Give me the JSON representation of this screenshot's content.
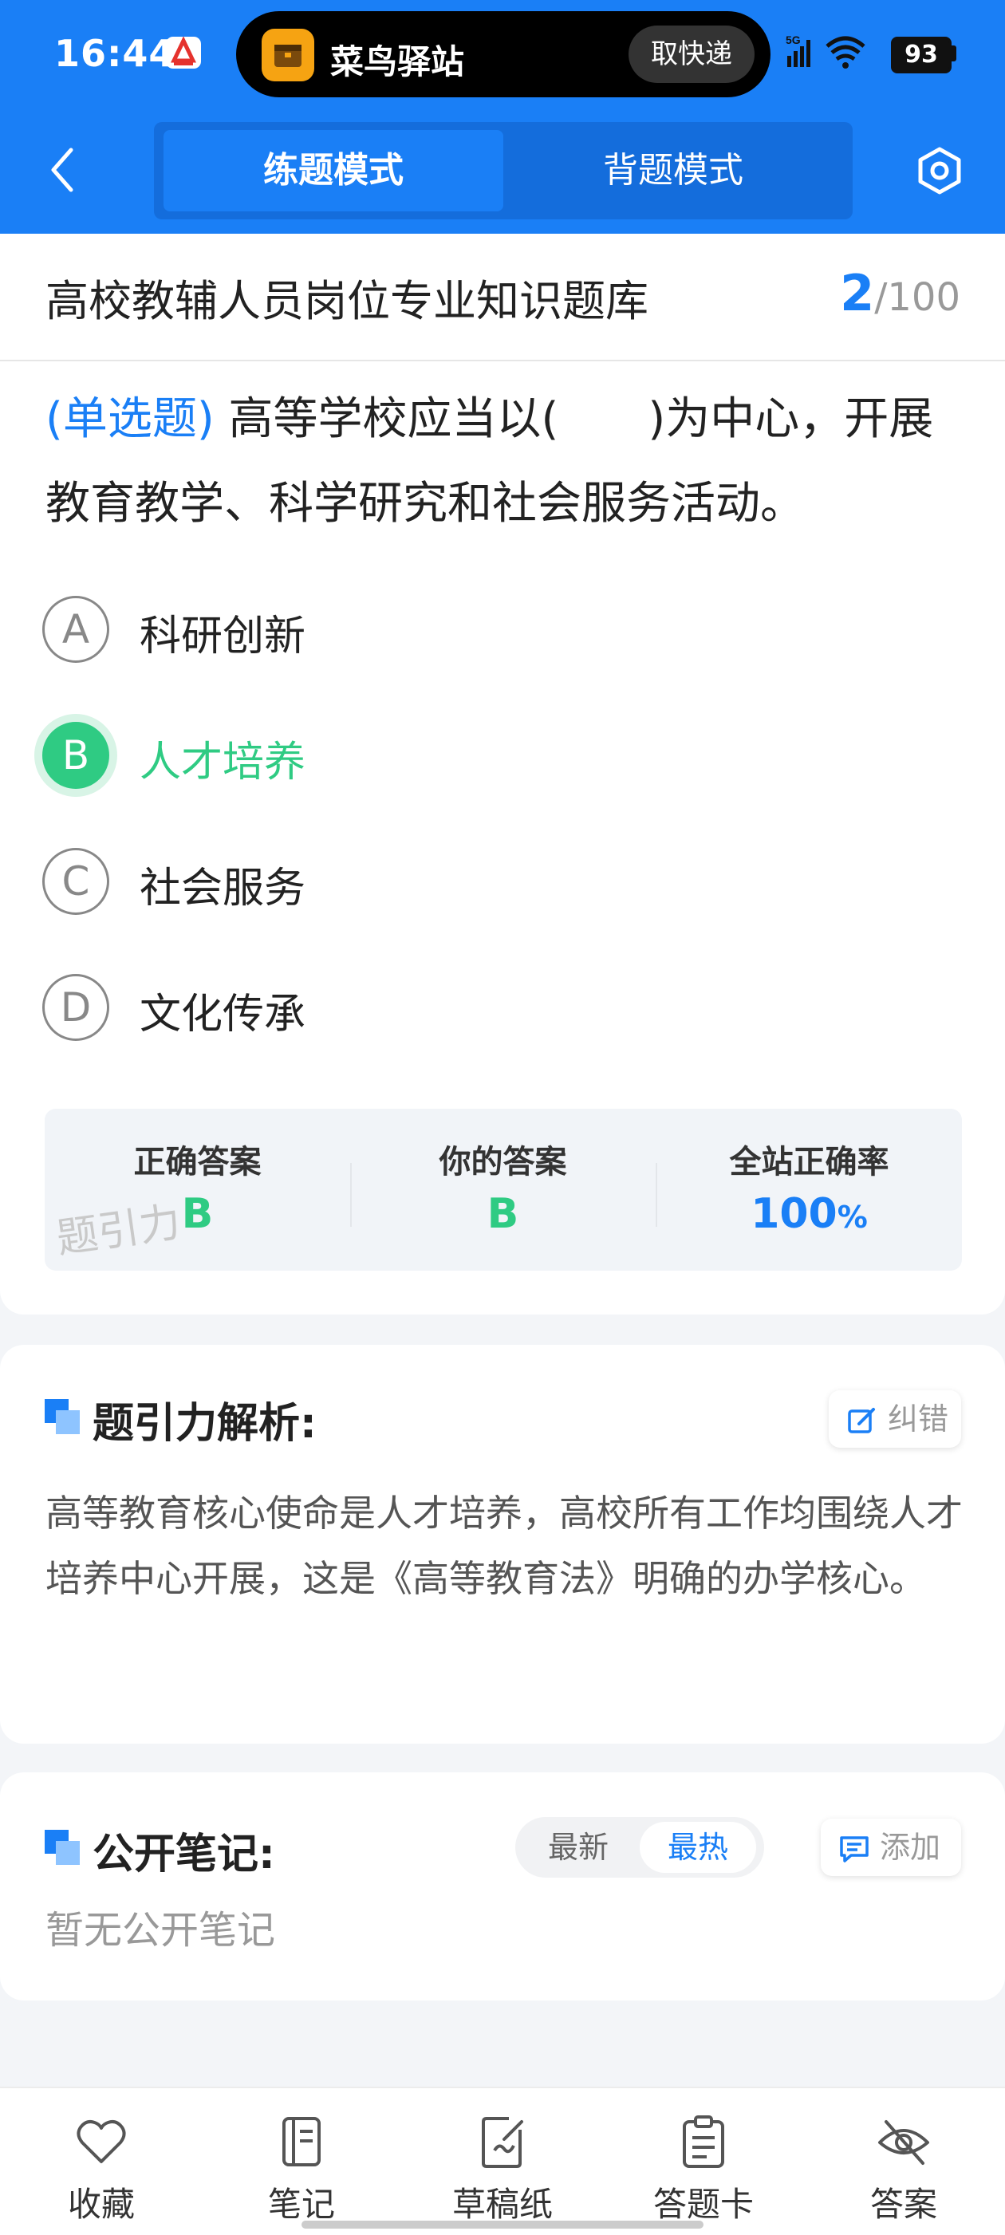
{
  "status_bar": {
    "time": "16:44",
    "island_app": "菜鸟驿站",
    "island_button": "取快递",
    "network": "5G",
    "battery": "93"
  },
  "header": {
    "tabs": [
      {
        "label": "练题模式",
        "active": true
      },
      {
        "label": "背题模式",
        "active": false
      }
    ],
    "accent_color": "#1a7ff6"
  },
  "question_bank": {
    "title": "高校教辅人员岗位专业知识题库",
    "current": "2",
    "total": "/100"
  },
  "question": {
    "type": "(单选题)",
    "text": "高等学校应当以(　　)为中心，开展教育教学、科学研究和社会服务活动。",
    "options": [
      {
        "letter": "A",
        "text": "科研创新",
        "selected": false
      },
      {
        "letter": "B",
        "text": "人才培养",
        "selected": true
      },
      {
        "letter": "C",
        "text": "社会服务",
        "selected": false
      },
      {
        "letter": "D",
        "text": "文化传承",
        "selected": false
      }
    ]
  },
  "stats": {
    "correct_label": "正确答案",
    "correct_value": "B",
    "yours_label": "你的答案",
    "yours_value": "B",
    "rate_label": "全站正确率",
    "rate_value": "100",
    "rate_unit": "%",
    "watermark": "题引力",
    "correct_color": "#2fcb83"
  },
  "analysis": {
    "title": "题引力解析:",
    "correct_button": "纠错",
    "text": "高等教育核心使命是人才培养，高校所有工作均围绕人才培养中心开展，这是《高等教育法》明确的办学核心。"
  },
  "notes": {
    "title": "公开笔记:",
    "sort_options": [
      "最新",
      "最热"
    ],
    "active_sort": "最热",
    "add_button": "添加",
    "empty_text": "暂无公开笔记"
  },
  "bottom_nav": {
    "items": [
      {
        "label": "收藏",
        "icon": "heart-icon"
      },
      {
        "label": "笔记",
        "icon": "notebook-icon"
      },
      {
        "label": "草稿纸",
        "icon": "draft-icon"
      },
      {
        "label": "答题卡",
        "icon": "answer-card-icon"
      },
      {
        "label": "答案",
        "icon": "eye-off-icon"
      }
    ]
  }
}
